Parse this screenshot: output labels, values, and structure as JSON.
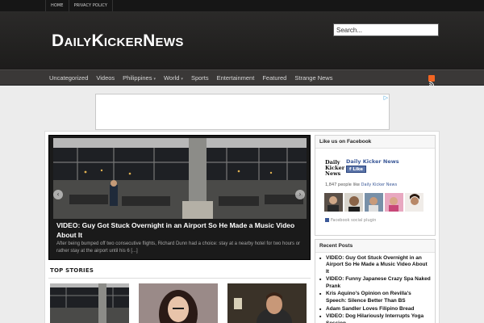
{
  "top_nav": {
    "items": [
      "HOME",
      "PRIVACY POLICY"
    ]
  },
  "site": {
    "title": "DailyKickerNews"
  },
  "search": {
    "placeholder": "Search..."
  },
  "main_nav": {
    "items": [
      {
        "label": "Uncategorized",
        "dropdown": false
      },
      {
        "label": "Videos",
        "dropdown": false
      },
      {
        "label": "Philippines",
        "dropdown": true
      },
      {
        "label": "World",
        "dropdown": true
      },
      {
        "label": "Sports",
        "dropdown": false
      },
      {
        "label": "Entertainment",
        "dropdown": false
      },
      {
        "label": "Featured",
        "dropdown": false
      },
      {
        "label": "Strange News",
        "dropdown": false
      }
    ],
    "rss_icon": "rss-icon"
  },
  "ad": {
    "badge": "▷"
  },
  "featured": {
    "title": "VIDEO: Guy Got Stuck Overnight in an Airport So He Made a Music Video About It",
    "excerpt": "After being bumped off two consecutive flights, Richard Dunn had a choice: stay at a nearby hotel for two hours or rather stay at the airport until his 6 [...]",
    "prev_icon": "chevron-left-icon",
    "next_icon": "chevron-right-icon"
  },
  "top_stories": {
    "heading": "TOP STORIES"
  },
  "facebook": {
    "heading": "Like us on Facebook",
    "logo_text": [
      "Daily",
      "Kicker",
      "News"
    ],
    "page_name": "Daily Kicker News",
    "like_label": "Like",
    "count_prefix": "1,847 people like",
    "count_page": "Daily Kicker News",
    "plugin_label": "Facebook social plugin"
  },
  "recent_posts": {
    "heading": "Recent Posts",
    "items": [
      "VIDEO: Guy Got Stuck Overnight in an Airport So He Made a Music Video About It",
      "VIDEO: Funny Japanese Crazy Spa Naked Prank",
      "Kris Aquino's Opinion on Revilla's Speech: Silence Better Than BS",
      "Adam Sandler Loves Filipino Bread",
      "VIDEO: Dog Hilariously Interrupts Yoga Session"
    ]
  },
  "colors": {
    "accent_link": "#3b5998",
    "rss": "#f26522",
    "header_bg": "#211f1e"
  }
}
